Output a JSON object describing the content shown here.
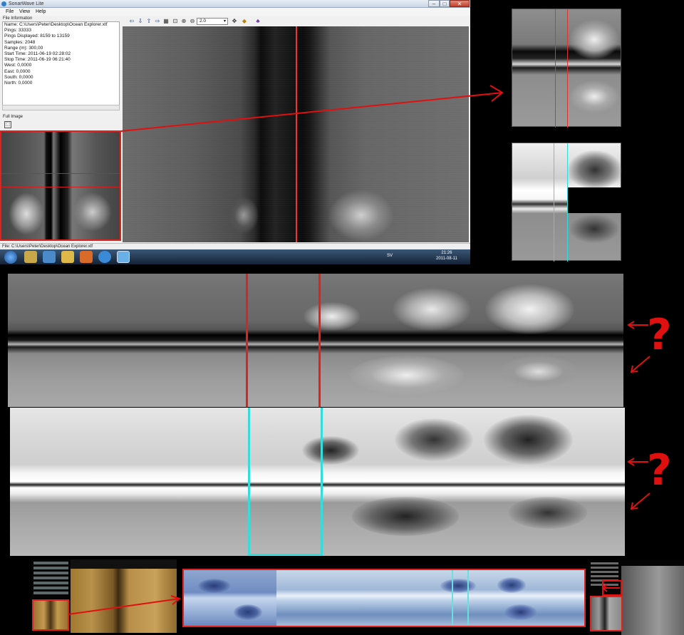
{
  "window": {
    "title": "SonarWave Lite",
    "controls": {
      "minimize": "–",
      "maximize": "□",
      "close": "✕"
    }
  },
  "menu": {
    "items": [
      "File",
      "View",
      "Help"
    ]
  },
  "file_info": {
    "panel_label": "File Information",
    "lines": [
      "Name: C:\\Users\\Peter\\Desktop\\Ocean Explorer.xtf",
      "Pings: 33333",
      "Pings Displayed: 8159 to 13159",
      "Samples: 2048",
      "Range (m): 300,00",
      "Start Time: 2011-06-19 02:28:02",
      "Stop Time: 2011-06-19 06:21:40",
      "West: 0,0000",
      "East: 0,0000",
      "South: 0,0000",
      "North: 0,0000"
    ]
  },
  "full_image": {
    "label": "Full Image"
  },
  "toolbar": {
    "buttons": [
      "arrow-left-icon",
      "arrow-down-icon",
      "arrow-up-icon",
      "arrow-right-icon",
      "grid-icon",
      "zoom-box-icon",
      "zoom-in-icon",
      "zoom-out-icon"
    ],
    "zoom_value": "2.0",
    "extra": [
      "pan-icon",
      "palette-icon",
      "settings-icon"
    ]
  },
  "status_bar": {
    "text": "File: C:\\Users\\Peter\\Desktop\\Ocean Explorer.xtf"
  },
  "taskbar": {
    "language": "SV",
    "time": "21:26",
    "date": "2011-08-11"
  },
  "annotations": {
    "question_mark_1": "?",
    "question_mark_2": "?"
  },
  "colors": {
    "highlight_red": "#dd2222",
    "highlight_cyan": "#33dddd",
    "question_red": "#e01010"
  }
}
